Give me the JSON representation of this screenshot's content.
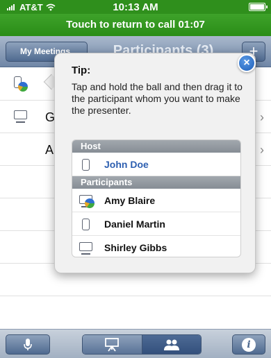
{
  "status_bar": {
    "carrier": "AT&T",
    "time": "10:13 AM",
    "signal_icon": "signal-bars-icon",
    "wifi_icon": "wifi-icon",
    "battery_icon": "battery-icon"
  },
  "call_bar": {
    "text": "Touch to return to call",
    "duration": "01:07"
  },
  "nav": {
    "back_label": "My Meetings",
    "title": "Participants (3)",
    "add_label": "+"
  },
  "list": {
    "rows": [
      {
        "lead": "",
        "icon": "phone-with-ball-icon"
      },
      {
        "lead": "G",
        "icon": "desktop-icon"
      },
      {
        "lead": "A",
        "icon": ""
      }
    ]
  },
  "tip": {
    "title": "Tip:",
    "text": "Tap and hold the ball and then drag it to the participant whom you want to make the presenter.",
    "close_icon": "close-x-icon",
    "host_header": "Host",
    "host": {
      "name": "John Doe",
      "icon": "phone-icon"
    },
    "participants_header": "Participants",
    "participants": [
      {
        "name": "Amy Blaire",
        "icon": "desktop-with-ball-icon"
      },
      {
        "name": "Daniel Martin",
        "icon": "phone-icon"
      },
      {
        "name": "Shirley Gibbs",
        "icon": "desktop-icon"
      }
    ]
  },
  "tab_bar": {
    "mic_icon": "microphone-icon",
    "presentation_icon": "presentation-icon",
    "participants_icon": "participants-icon",
    "info_icon": "info-icon",
    "info_glyph": "i"
  }
}
